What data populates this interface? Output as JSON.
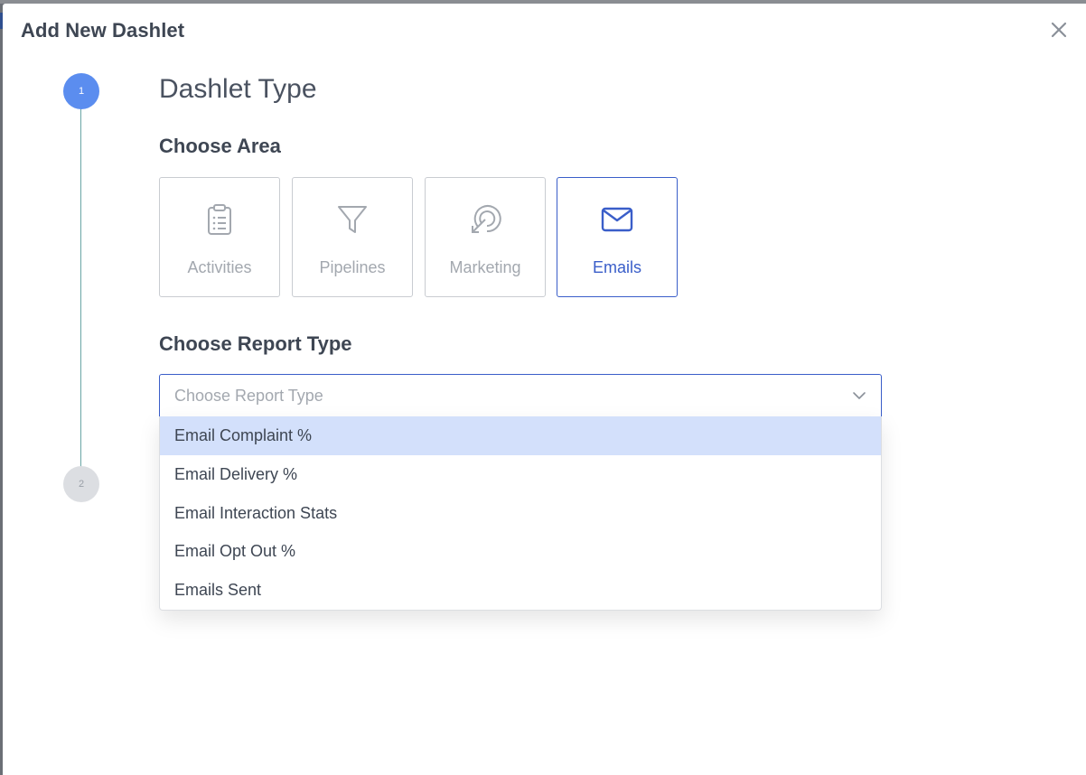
{
  "modal": {
    "title": "Add New Dashlet",
    "close_icon": "close-icon"
  },
  "stepper": {
    "steps": [
      {
        "number": "1",
        "state": "active",
        "color": "#5b8def"
      },
      {
        "number": "2",
        "state": "inactive",
        "color": "#dcdee2"
      }
    ]
  },
  "step1": {
    "heading": "Dashlet Type",
    "choose_area_label": "Choose Area",
    "areas": [
      {
        "label": "Activities",
        "icon": "clipboard-list-icon",
        "selected": false
      },
      {
        "label": "Pipelines",
        "icon": "funnel-icon",
        "selected": false
      },
      {
        "label": "Marketing",
        "icon": "target-arrow-icon",
        "selected": false
      },
      {
        "label": "Emails",
        "icon": "envelope-icon",
        "selected": true
      }
    ],
    "choose_report_label": "Choose Report Type",
    "report_select": {
      "placeholder": "Choose Report Type",
      "chevron_icon": "chevron-down-icon",
      "options": [
        {
          "label": "Email Complaint %",
          "highlighted": true
        },
        {
          "label": "Email Delivery %",
          "highlighted": false
        },
        {
          "label": "Email Interaction Stats",
          "highlighted": false
        },
        {
          "label": "Email Opt Out %",
          "highlighted": false
        },
        {
          "label": "Emails Sent",
          "highlighted": false
        }
      ]
    }
  },
  "colors": {
    "accent": "#3a5ec9",
    "step_active": "#5b8def",
    "option_highlight": "#d3e0fb",
    "muted_text": "#a3a8af",
    "heading_text": "#3e4653"
  }
}
